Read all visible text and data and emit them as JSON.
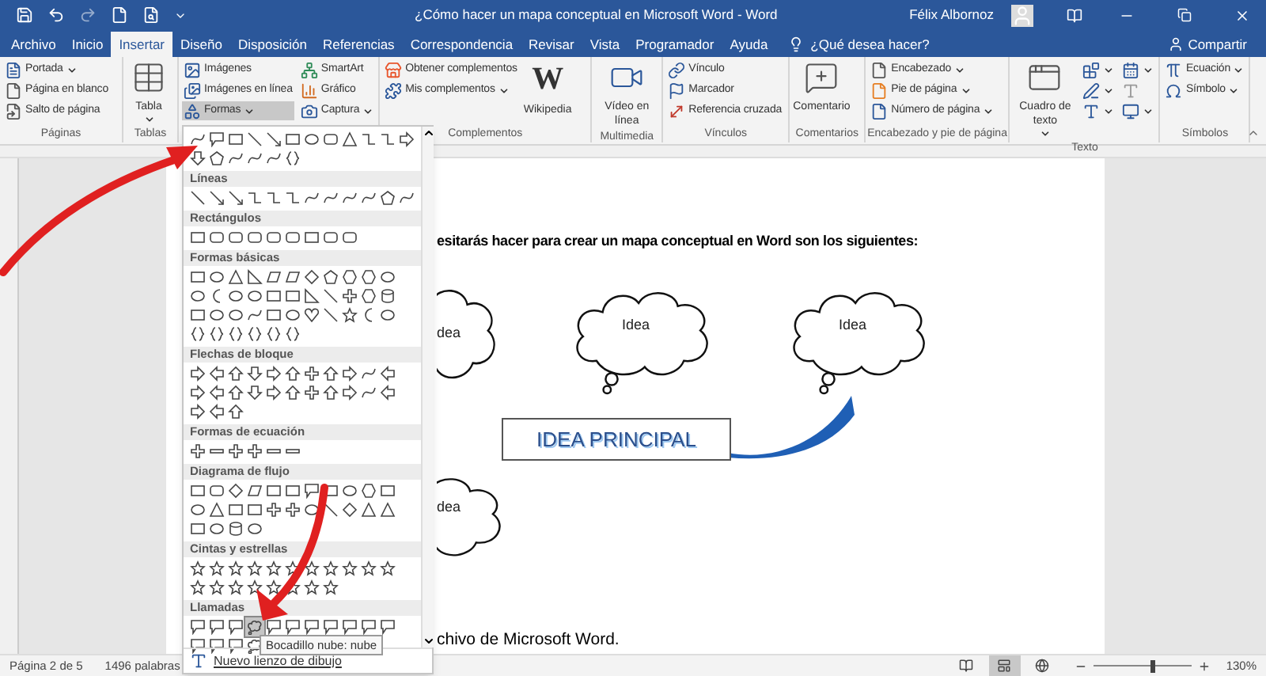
{
  "title_bar": {
    "title": "¿Cómo hacer un mapa conceptual en Microsoft Word  -  Word",
    "user": "Félix Albornoz"
  },
  "tabs": [
    {
      "label": "Archivo",
      "selected": false
    },
    {
      "label": "Inicio",
      "selected": false
    },
    {
      "label": "Insertar",
      "selected": true
    },
    {
      "label": "Diseño",
      "selected": false
    },
    {
      "label": "Disposición",
      "selected": false
    },
    {
      "label": "Referencias",
      "selected": false
    },
    {
      "label": "Correspondencia",
      "selected": false
    },
    {
      "label": "Revisar",
      "selected": false
    },
    {
      "label": "Vista",
      "selected": false
    },
    {
      "label": "Programador",
      "selected": false
    },
    {
      "label": "Ayuda",
      "selected": false
    }
  ],
  "tell_me": {
    "placeholder": "¿Qué desea hacer?"
  },
  "share": "Compartir",
  "ribbon": {
    "groups": [
      {
        "label": "Páginas",
        "items": [
          {
            "kind": "small",
            "label": "Portada",
            "dropdown": true
          },
          {
            "kind": "small",
            "label": "Página en blanco",
            "dropdown": false
          },
          {
            "kind": "small",
            "label": "Salto de página",
            "dropdown": false
          }
        ]
      },
      {
        "label": "Tablas",
        "items": [
          {
            "kind": "large",
            "label": "Tabla",
            "dropdown": true
          }
        ]
      },
      {
        "items": [
          {
            "kind": "small",
            "label": "Imágenes",
            "dropdown": false
          },
          {
            "kind": "small",
            "label": "Imágenes en línea",
            "dropdown": false
          },
          {
            "kind": "small",
            "label": "Formas",
            "dropdown": true,
            "expanded": true
          },
          {
            "kind": "small",
            "label": "SmartArt",
            "dropdown": false
          },
          {
            "kind": "small",
            "label": "Gráfico",
            "dropdown": false
          },
          {
            "kind": "small",
            "label": "Captura",
            "dropdown": true
          }
        ]
      },
      {
        "label": "Complementos",
        "items": [
          {
            "kind": "small",
            "label": "Obtener complementos",
            "dropdown": false
          },
          {
            "kind": "small",
            "label": "Mis complementos",
            "dropdown": true
          },
          {
            "kind": "large",
            "label": "Wikipedia",
            "logo": "W",
            "dropdown": false
          }
        ]
      },
      {
        "label": "Multimedia",
        "items": [
          {
            "kind": "large",
            "label": "Vídeo en línea",
            "dropdown": false
          }
        ]
      },
      {
        "label": "Vínculos",
        "items": [
          {
            "kind": "small",
            "label": "Vínculo",
            "dropdown": false
          },
          {
            "kind": "small",
            "label": "Marcador",
            "dropdown": false
          },
          {
            "kind": "small",
            "label": "Referencia cruzada",
            "dropdown": false
          }
        ]
      },
      {
        "label": "Comentarios",
        "items": [
          {
            "kind": "large",
            "label": "Comentario",
            "dropdown": false
          }
        ]
      },
      {
        "label": "Encabezado y pie de página",
        "items": [
          {
            "kind": "small",
            "label": "Encabezado",
            "dropdown": true
          },
          {
            "kind": "small",
            "label": "Pie de página",
            "dropdown": true
          },
          {
            "kind": "small",
            "label": "Número de página",
            "dropdown": true
          }
        ]
      },
      {
        "label": "Texto",
        "items": [
          {
            "kind": "large",
            "label": "Cuadro de texto",
            "dropdown": true
          },
          {
            "kind": "icon",
            "dropdown": true
          },
          {
            "kind": "icon",
            "dropdown": true
          },
          {
            "kind": "icon",
            "dropdown": true
          },
          {
            "kind": "icon",
            "dropdown": true
          },
          {
            "kind": "icon",
            "dropdown": false
          },
          {
            "kind": "icon",
            "dropdown": true
          }
        ]
      },
      {
        "label": "Símbolos",
        "items": [
          {
            "kind": "small",
            "label": "Ecuación",
            "dropdown": true
          },
          {
            "kind": "small",
            "label": "Símbolo",
            "dropdown": true
          }
        ]
      }
    ]
  },
  "shapes_menu": {
    "sections": [
      {
        "kind": "recent"
      },
      {
        "kind": "lines",
        "title": "Líneas"
      },
      {
        "kind": "rectangles",
        "title": "Rectángulos"
      },
      {
        "kind": "basic",
        "title": "Formas básicas"
      },
      {
        "kind": "arrows",
        "title": "Flechas de bloque"
      },
      {
        "kind": "equation",
        "title": "Formas de ecuación"
      },
      {
        "kind": "flowchart",
        "title": "Diagrama de flujo"
      },
      {
        "kind": "stars",
        "title": "Cintas y estrellas"
      },
      {
        "kind": "callouts",
        "title": "Llamadas",
        "shapes": [
          {
            "selected": false
          },
          {
            "selected": false
          },
          {
            "selected": false
          },
          {
            "selected": true
          },
          {
            "selected": false
          },
          {
            "selected": false
          },
          {
            "selected": false
          },
          {
            "selected": false
          },
          {
            "selected": false
          },
          {
            "selected": false
          },
          {
            "selected": false
          },
          {
            "selected": false
          },
          {
            "selected": false
          },
          {
            "selected": false
          },
          {
            "selected": false
          }
        ]
      }
    ],
    "footer": "Nuevo lienzo de dibujo",
    "tooltip": "Bocadillo nube: nube"
  },
  "document": {
    "heading": "esitarás hacer para crear un mapa conceptual en Word son los siguientes:",
    "clouds": [
      {
        "label": "dea"
      },
      {
        "label": "Idea"
      },
      {
        "label": "Idea"
      },
      {
        "label": "dea"
      }
    ],
    "main_idea": "IDEA PRINCIPAL",
    "closing_text": "chivo de Microsoft Word."
  },
  "status_bar": {
    "page": "Página 2 de 5",
    "words": "1496 palabras",
    "views": [
      {
        "selected": false
      },
      {
        "selected": true
      },
      {
        "selected": false
      }
    ],
    "zoom": {
      "level": 0.6,
      "reading": "130%"
    }
  }
}
